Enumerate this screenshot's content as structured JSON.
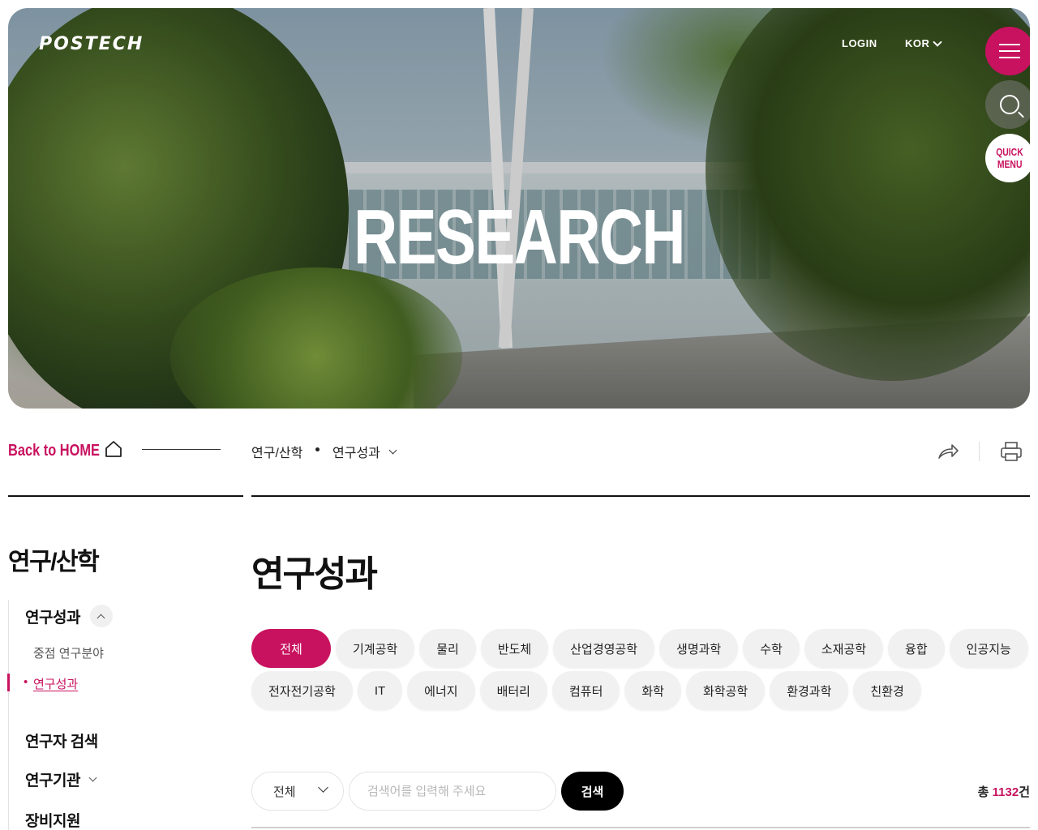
{
  "header": {
    "logo": "POSTECH",
    "login": "LOGIN",
    "language": "KOR",
    "quick_menu_line1": "QUICK",
    "quick_menu_line2": "MENU"
  },
  "hero": {
    "title": "RESEARCH"
  },
  "breadcrumb": {
    "back_home": "Back to HOME",
    "level1": "연구/산학",
    "level2": "연구성과"
  },
  "sidebar": {
    "title": "연구/산학",
    "items": [
      {
        "label": "연구성과"
      },
      {
        "label": "연구자 검색"
      },
      {
        "label": "연구기관"
      },
      {
        "label": "장비지원"
      }
    ],
    "subitems": [
      {
        "label": "중점 연구분야"
      },
      {
        "label": "연구성과"
      }
    ]
  },
  "main": {
    "title": "연구성과",
    "categories_row1": [
      "전체",
      "기계공학",
      "물리",
      "반도체",
      "산업경영공학",
      "생명과학",
      "수학",
      "소재공학",
      "융합",
      "인공지능"
    ],
    "categories_row2": [
      "전자전기공학",
      "IT",
      "에너지",
      "배터리",
      "컴퓨터",
      "화학",
      "화학공학",
      "환경과학",
      "친환경"
    ],
    "active_category": "전체",
    "search": {
      "select_value": "전체",
      "placeholder": "검색어를 입력해 주세요",
      "button": "검색"
    },
    "total": {
      "prefix": "총 ",
      "count": "1132",
      "suffix": "건"
    }
  },
  "colors": {
    "accent": "#c8125f"
  },
  "icons": [
    "menu-icon",
    "search-icon",
    "home-icon",
    "share-icon",
    "print-icon",
    "chevron-down-icon",
    "chevron-up-icon"
  ]
}
